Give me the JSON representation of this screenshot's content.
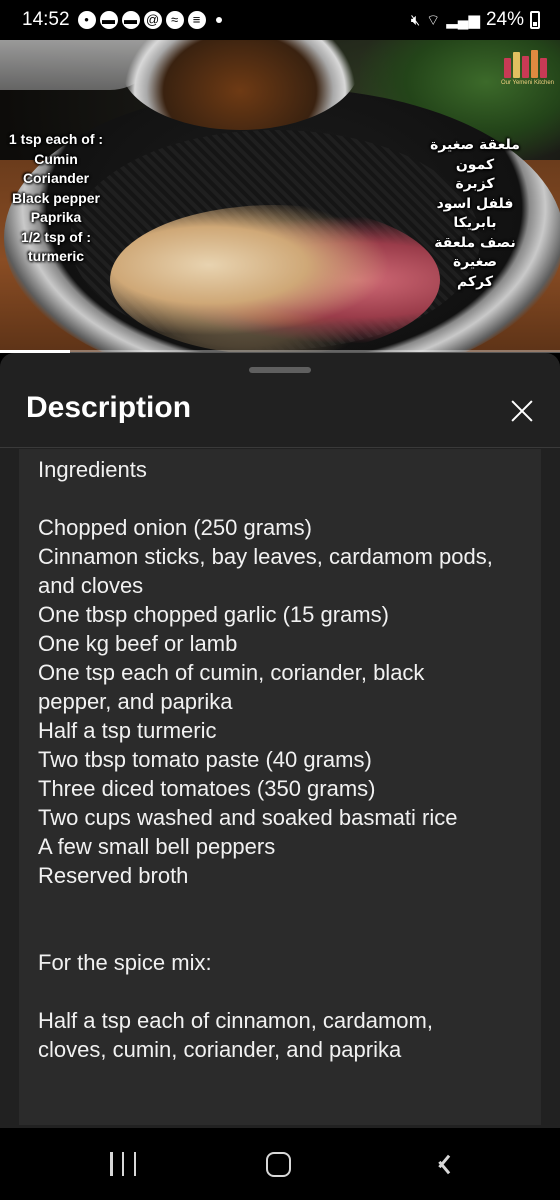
{
  "status_bar": {
    "time": "14:52",
    "battery": "24%"
  },
  "video": {
    "caption_en": [
      "1 tsp each of :",
      "Cumin",
      "Coriander",
      "Black pepper",
      "Paprika",
      "1/2 tsp of :",
      "turmeric"
    ],
    "caption_ar": [
      "ملعقة صغيرة",
      "كمون",
      "كزبرة",
      "فلفل اسود",
      "بابريكا",
      "نصف ملعقة صغيرة",
      "كركم"
    ],
    "logo_text": "Our Yemeni Kitchen",
    "progress": 0.125
  },
  "sheet": {
    "title": "Description",
    "description_lines": [
      "Ingredients",
      "",
      "Chopped onion (250 grams)",
      "Cinnamon sticks, bay leaves, cardamom pods,",
      "and cloves",
      "One tbsp chopped garlic (15 grams)",
      "One kg beef or lamb",
      "One tsp each of cumin, coriander, black",
      "pepper, and paprika",
      "Half a tsp turmeric",
      "Two tbsp tomato paste (40 grams)",
      "Three diced tomatoes (350 grams)",
      "Two cups washed and soaked basmati rice",
      "A few small bell peppers",
      "Reserved broth",
      "",
      "",
      "For the spice mix:",
      "",
      "Half a tsp each of cinnamon, cardamom,",
      "cloves, cumin, coriander, and paprika"
    ]
  },
  "icons": {
    "close": "close-icon",
    "recents": "recents-icon",
    "home": "home-icon",
    "back": "back-icon"
  }
}
